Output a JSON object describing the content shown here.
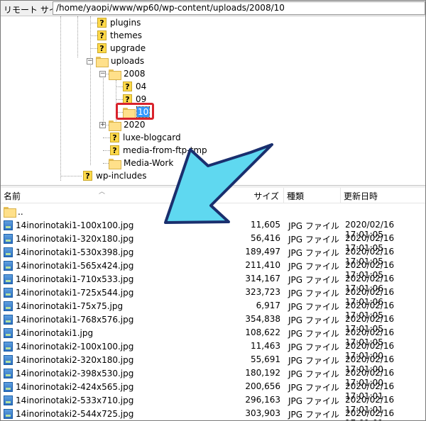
{
  "pathbar": {
    "label": "リモート サイト:",
    "path": "/home/yaopi/www/wp60/wp-content/uploads/2008/10"
  },
  "tree": {
    "items": [
      {
        "label": "plugins",
        "icon": "question-folder-icon"
      },
      {
        "label": "themes",
        "icon": "question-folder-icon"
      },
      {
        "label": "upgrade",
        "icon": "question-folder-icon"
      },
      {
        "label": "uploads",
        "icon": "folder-icon"
      },
      {
        "label": "2008",
        "icon": "folder-icon"
      },
      {
        "label": "04",
        "icon": "question-folder-icon"
      },
      {
        "label": "09",
        "icon": "question-folder-icon"
      },
      {
        "label": "10",
        "icon": "folder-icon",
        "selected": true
      },
      {
        "label": "2020",
        "icon": "folder-icon"
      },
      {
        "label": "luxe-blogcard",
        "icon": "question-folder-icon"
      },
      {
        "label": "media-from-ftp-tmp",
        "icon": "question-folder-icon"
      },
      {
        "label": "Media-Work",
        "icon": "folder-icon"
      },
      {
        "label": "wp-includes",
        "icon": "question-folder-icon"
      }
    ]
  },
  "list": {
    "headers": {
      "name": "名前",
      "size": "サイズ",
      "type": "種類",
      "modified": "更新日時"
    },
    "parent_dir": "..",
    "files": [
      {
        "name": "14inorinotaki1-100x100.jpg",
        "size": "11,605",
        "type": "JPG ファイル",
        "modified": "2020/02/16 17:01:05"
      },
      {
        "name": "14inorinotaki1-320x180.jpg",
        "size": "56,416",
        "type": "JPG ファイル",
        "modified": "2020/02/16 17:01:05"
      },
      {
        "name": "14inorinotaki1-530x398.jpg",
        "size": "189,497",
        "type": "JPG ファイル",
        "modified": "2020/02/16 17:01:05"
      },
      {
        "name": "14inorinotaki1-565x424.jpg",
        "size": "211,410",
        "type": "JPG ファイル",
        "modified": "2020/02/16 17:01:05"
      },
      {
        "name": "14inorinotaki1-710x533.jpg",
        "size": "314,167",
        "type": "JPG ファイル",
        "modified": "2020/02/16 17:01:06"
      },
      {
        "name": "14inorinotaki1-725x544.jpg",
        "size": "323,723",
        "type": "JPG ファイル",
        "modified": "2020/02/16 17:01:06"
      },
      {
        "name": "14inorinotaki1-75x75.jpg",
        "size": "6,917",
        "type": "JPG ファイル",
        "modified": "2020/02/16 17:01:05"
      },
      {
        "name": "14inorinotaki1-768x576.jpg",
        "size": "354,838",
        "type": "JPG ファイル",
        "modified": "2020/02/16 17:01:05"
      },
      {
        "name": "14inorinotaki1.jpg",
        "size": "108,622",
        "type": "JPG ファイル",
        "modified": "2020/02/16 17:01:05"
      },
      {
        "name": "14inorinotaki2-100x100.jpg",
        "size": "11,463",
        "type": "JPG ファイル",
        "modified": "2020/02/16 17:01:00"
      },
      {
        "name": "14inorinotaki2-320x180.jpg",
        "size": "55,691",
        "type": "JPG ファイル",
        "modified": "2020/02/16 17:01:00"
      },
      {
        "name": "14inorinotaki2-398x530.jpg",
        "size": "180,192",
        "type": "JPG ファイル",
        "modified": "2020/02/16 17:01:00"
      },
      {
        "name": "14inorinotaki2-424x565.jpg",
        "size": "200,656",
        "type": "JPG ファイル",
        "modified": "2020/02/16 17:01:01"
      },
      {
        "name": "14inorinotaki2-533x710.jpg",
        "size": "296,163",
        "type": "JPG ファイル",
        "modified": "2020/02/16 17:01:01"
      },
      {
        "name": "14inorinotaki2-544x725.jpg",
        "size": "303,903",
        "type": "JPG ファイル",
        "modified": "2020/02/16 17:01:01"
      }
    ]
  },
  "colors": {
    "highlight": "#d9232c",
    "arrow_fill": "#5fd8f0",
    "arrow_stroke": "#1a2f6e",
    "selection": "#3399ff"
  }
}
